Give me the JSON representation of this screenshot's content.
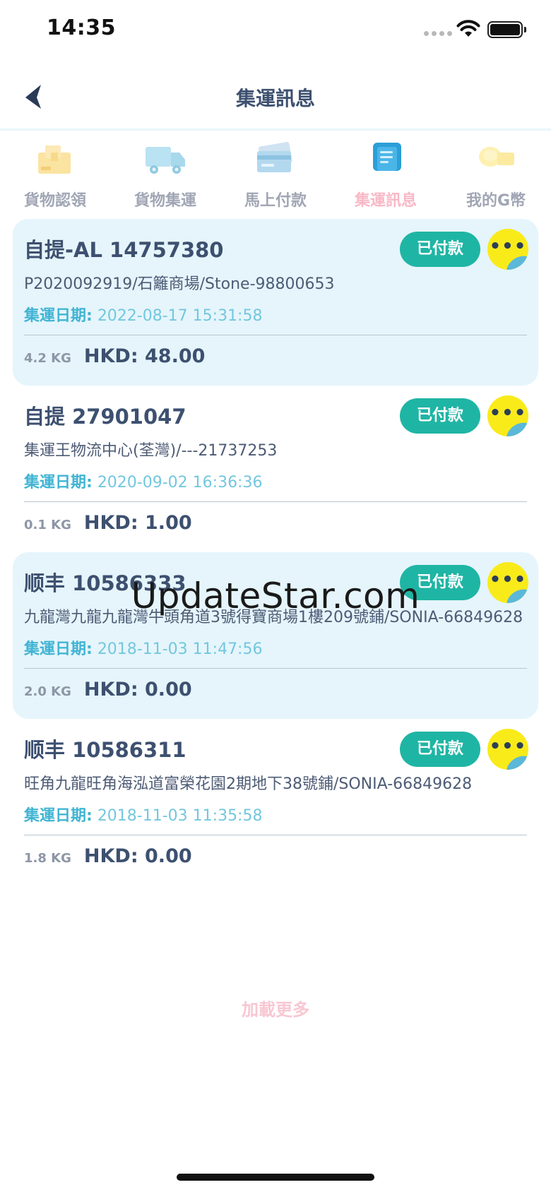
{
  "status_bar": {
    "time": "14:35"
  },
  "header": {
    "title": "集運訊息"
  },
  "tabs": [
    {
      "label": "貨物認領",
      "icon": "package-box-icon",
      "active": false
    },
    {
      "label": "貨物集運",
      "icon": "delivery-truck-icon",
      "active": false
    },
    {
      "label": "馬上付款",
      "icon": "credit-card-icon",
      "active": false
    },
    {
      "label": "集運訊息",
      "icon": "receipt-icon",
      "active": true
    },
    {
      "label": "我的G幣",
      "icon": "coins-icon",
      "active": false
    }
  ],
  "orders": [
    {
      "title": "自提-AL 14757380",
      "status": "已付款",
      "address": "P2020092919/石籬商場/Stone-98800653",
      "date_label": "集運日期:",
      "date": "2022-08-17 15:31:58",
      "weight": "4.2 KG",
      "price": "HKD: 48.00"
    },
    {
      "title": "自提 27901047",
      "status": "已付款",
      "address": "集運王物流中心(荃灣)/---21737253",
      "date_label": "集運日期:",
      "date": "2020-09-02 16:36:36",
      "weight": "0.1 KG",
      "price": "HKD: 1.00"
    },
    {
      "title": "顺丰 10586333",
      "status": "已付款",
      "address": "九龍灣九龍九龍灣牛頭角道3號得寶商場1樓209號鋪/SONIA-66849628",
      "date_label": "集運日期:",
      "date": "2018-11-03 11:47:56",
      "weight": "2.0 KG",
      "price": "HKD: 0.00"
    },
    {
      "title": "顺丰 10586311",
      "status": "已付款",
      "address": "旺角九龍旺角海泓道富榮花園2期地下38號鋪/SONIA-66849628",
      "date_label": "集運日期:",
      "date": "2018-11-03 11:35:58",
      "weight": "1.8 KG",
      "price": "HKD: 0.00"
    }
  ],
  "more_button": {
    "label": "•••"
  },
  "load_more": "加載更多",
  "watermark": "UpdateStar.com"
}
